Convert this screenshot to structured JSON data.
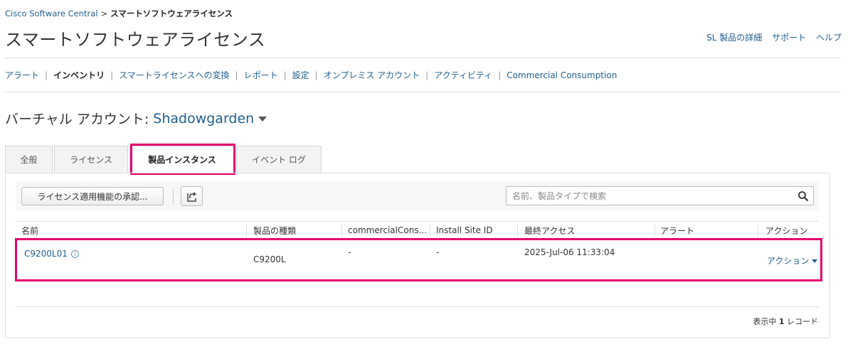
{
  "breadcrumb": {
    "root": "Cisco Software Central",
    "separator": ">",
    "current": "スマートソフトウェアライセンス"
  },
  "page_title": "スマートソフトウェアライセンス",
  "top_links": {
    "details": "SL 製品の詳細",
    "support": "サポート",
    "help": "ヘルプ"
  },
  "nav": {
    "items": [
      {
        "label": "アラート"
      },
      {
        "label": "インベントリ"
      },
      {
        "label": "スマートライセンスへの変換"
      },
      {
        "label": "レポート"
      },
      {
        "label": "設定"
      },
      {
        "label": "オンプレミス アカウント"
      },
      {
        "label": "アクティビティ"
      },
      {
        "label": "Commercial Consumption"
      }
    ],
    "separator": "|",
    "active": "インベントリ"
  },
  "virtual_account": {
    "label": "バーチャル アカウント:",
    "name": "Shadowgarden"
  },
  "tabs": [
    {
      "label": "全般"
    },
    {
      "label": "ライセンス"
    },
    {
      "label": "製品インスタンス"
    },
    {
      "label": "イベント ログ"
    }
  ],
  "active_tab": "製品インスタンス",
  "toolbar": {
    "approve_label": "ライセンス適用機能の承認...",
    "search_placeholder": "名前、製品タイプで検索"
  },
  "table": {
    "columns": [
      "名前",
      "製品の種類",
      "commercialCons...",
      "Install Site ID",
      "最終アクセス",
      "アラート",
      "アクション"
    ],
    "rows": [
      {
        "name": "C9200L01",
        "product_type": "C9200L",
        "commercial": "-",
        "install_site_id": "-",
        "last_access": "2025-Jul-06 11:33:04",
        "alert": "",
        "action": "アクション"
      }
    ]
  },
  "footer": {
    "prefix": "表示中",
    "count": "1",
    "suffix": "レコード"
  },
  "colors": {
    "link": "#1e5f8f",
    "highlight": "#e5006e",
    "border": "#dddddd"
  }
}
